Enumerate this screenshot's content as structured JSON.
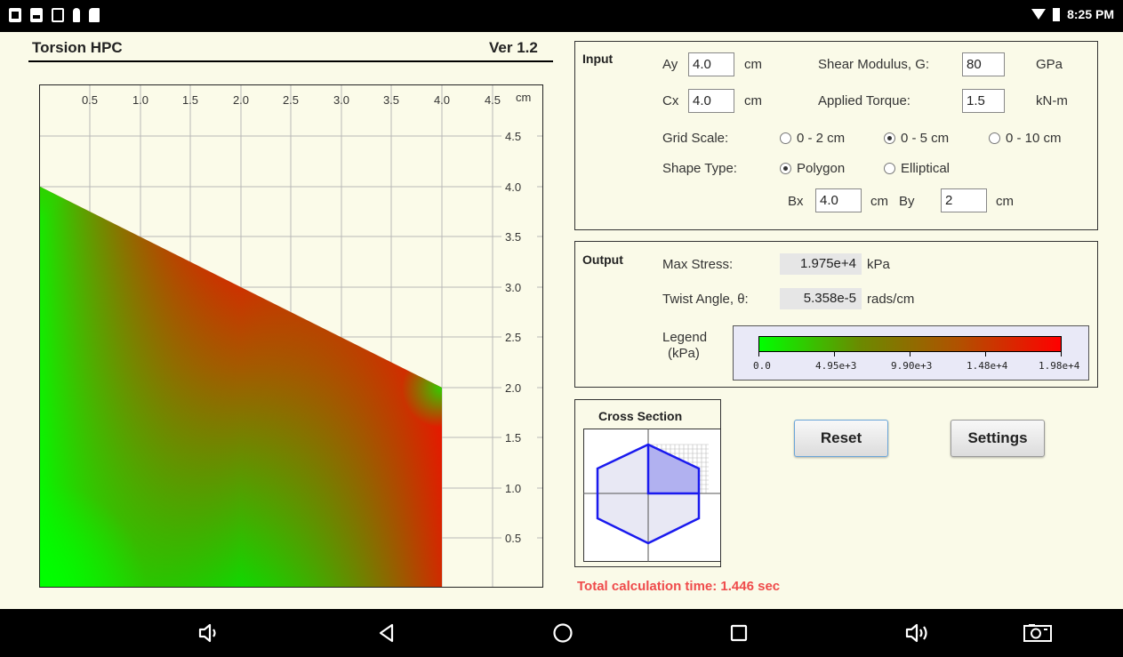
{
  "status_bar": {
    "time": "8:25 PM"
  },
  "header": {
    "title": "Torsion HPC",
    "version": "Ver 1.2"
  },
  "plot": {
    "unit": "cm",
    "x_ticks": [
      "0.5",
      "1.0",
      "1.5",
      "2.0",
      "2.5",
      "3.0",
      "3.5",
      "4.0",
      "4.5"
    ],
    "y_ticks": [
      "4.5",
      "4.0",
      "3.5",
      "3.0",
      "2.5",
      "2.0",
      "1.5",
      "1.0",
      "0.5"
    ]
  },
  "input": {
    "title": "Input",
    "ay_label": "Ay",
    "ay_value": "4.0",
    "ay_unit": "cm",
    "cx_label": "Cx",
    "cx_value": "4.0",
    "cx_unit": "cm",
    "shear_label": "Shear Modulus, G:",
    "shear_value": "80",
    "shear_unit": "GPa",
    "torque_label": "Applied Torque:",
    "torque_value": "1.5",
    "torque_unit": "kN-m",
    "grid_label": "Grid Scale:",
    "grid_options": [
      "0 - 2  cm",
      "0 - 5  cm",
      "0 - 10  cm"
    ],
    "grid_selected": "0 - 5  cm",
    "shape_label": "Shape Type:",
    "shape_options": [
      "Polygon",
      "Elliptical"
    ],
    "shape_selected": "Polygon",
    "bx_label": "Bx",
    "bx_value": "4.0",
    "bx_unit": "cm",
    "by_label": "By",
    "by_value": "2",
    "by_unit": "cm"
  },
  "output": {
    "title": "Output",
    "max_stress_label": "Max Stress:",
    "max_stress_value": "1.975e+4",
    "max_stress_unit": "kPa",
    "twist_label": "Twist Angle, θ:",
    "twist_value": "5.358e-5",
    "twist_unit": "rads/cm",
    "legend_label_1": "Legend",
    "legend_label_2": "(kPa)",
    "legend_ticks": [
      "0.0",
      "4.95e+3",
      "9.90e+3",
      "1.48e+4",
      "1.98e+4"
    ],
    "legend_colors": {
      "low": "#00ff00",
      "high": "#ff0000"
    }
  },
  "cross_section": {
    "title": "Cross Section"
  },
  "buttons": {
    "reset": "Reset",
    "settings": "Settings"
  },
  "calc_time": "Total calculation time: 1.446 sec",
  "colors": {
    "accent_red": "#ef4b4b",
    "shape_blue": "#1a1aee"
  }
}
